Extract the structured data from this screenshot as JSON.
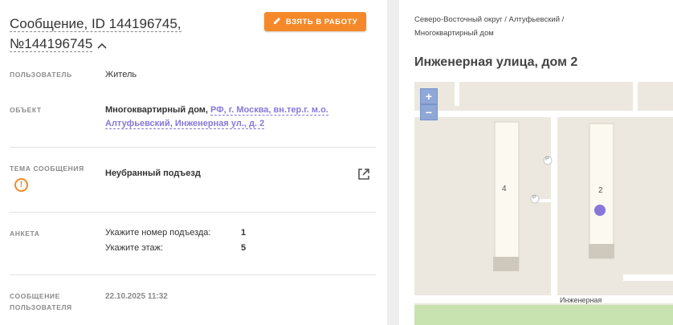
{
  "header": {
    "title_line1": "Сообщение, ID 144196745,",
    "title_line2": "№144196745",
    "take_button_label": "ВЗЯТЬ В РАБОТУ",
    "accent_color": "#f5892a"
  },
  "fields": {
    "user": {
      "label": "ПОЛЬЗОВАТЕЛЬ",
      "value": "Житель"
    },
    "object": {
      "label": "ОБЪЕКТ",
      "type": "Многоквартирный дом,",
      "address_link": "РФ, г. Москва, вн.тер.г. м.о. Алтуфьевский, Инженерная ул., д. 2"
    },
    "topic": {
      "label": "ТЕМА СООБЩЕНИЯ",
      "value": "Неубранный подъезд",
      "icon": "warning-icon"
    },
    "survey": {
      "label": "АНКЕТА",
      "rows": [
        {
          "question": "Укажите номер подъезда:",
          "answer": "1"
        },
        {
          "question": "Укажите этаж:",
          "answer": "5"
        }
      ]
    },
    "message": {
      "label_line1": "СООБЩЕНИЕ",
      "label_line2": "ПОЛЬЗОВАТЕЛЯ",
      "value": "22.10.2025 11:32"
    }
  },
  "location": {
    "breadcrumb_line1": "Северо-Восточный округ / Алтуфьевский /",
    "breadcrumb_line2": "Многоквартирный дом",
    "address": "Инженерная улица, дом 2"
  },
  "map": {
    "zoom_in": "+",
    "zoom_out": "−",
    "building_left_label": "4",
    "building_right_label": "2",
    "parking_label": "P",
    "street_label": "Инженерная",
    "marker_color": "#8877d8"
  }
}
